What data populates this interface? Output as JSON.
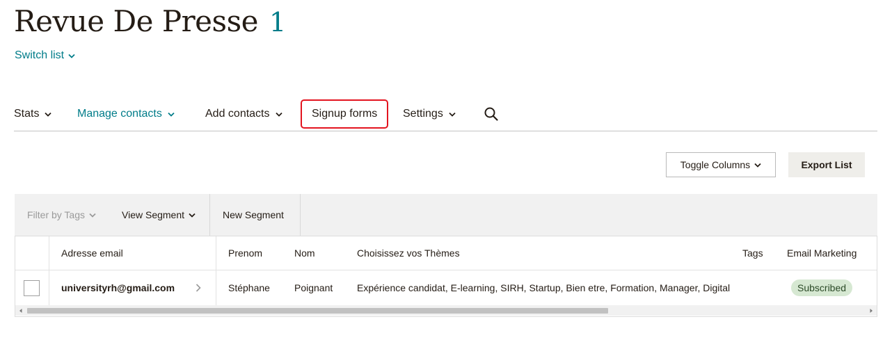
{
  "header": {
    "title": "Revue De Presse",
    "count": "1",
    "switch_list": "Switch list"
  },
  "nav": {
    "items": [
      {
        "label": "Stats",
        "has_dropdown": true
      },
      {
        "label": "Manage contacts",
        "has_dropdown": true,
        "active": true
      },
      {
        "label": "Add contacts",
        "has_dropdown": true
      },
      {
        "label": "Signup forms",
        "has_dropdown": false,
        "highlighted": true
      },
      {
        "label": "Settings",
        "has_dropdown": true
      }
    ],
    "search_icon": "search-icon"
  },
  "actions": {
    "toggle_columns": "Toggle Columns",
    "export_list": "Export List"
  },
  "filters": {
    "filter_by_tags": "Filter by Tags",
    "view_segment": "View Segment",
    "new_segment": "New Segment"
  },
  "table": {
    "columns": [
      "Adresse email",
      "Prenom",
      "Nom",
      "Choisissez vos Thèmes",
      "Tags",
      "Email Marketing"
    ],
    "rows": [
      {
        "email": "universityrh@gmail.com",
        "prenom": "Stéphane",
        "nom": "Poignant",
        "themes": "Expérience candidat, E-learning, SIRH, Startup, Bien etre, Formation, Manager, Digital",
        "tags": "",
        "email_marketing": "Subscribed"
      }
    ]
  },
  "colors": {
    "accent": "#007c89",
    "highlight_border": "#e3141f",
    "badge_bg": "#d6e8d2"
  }
}
